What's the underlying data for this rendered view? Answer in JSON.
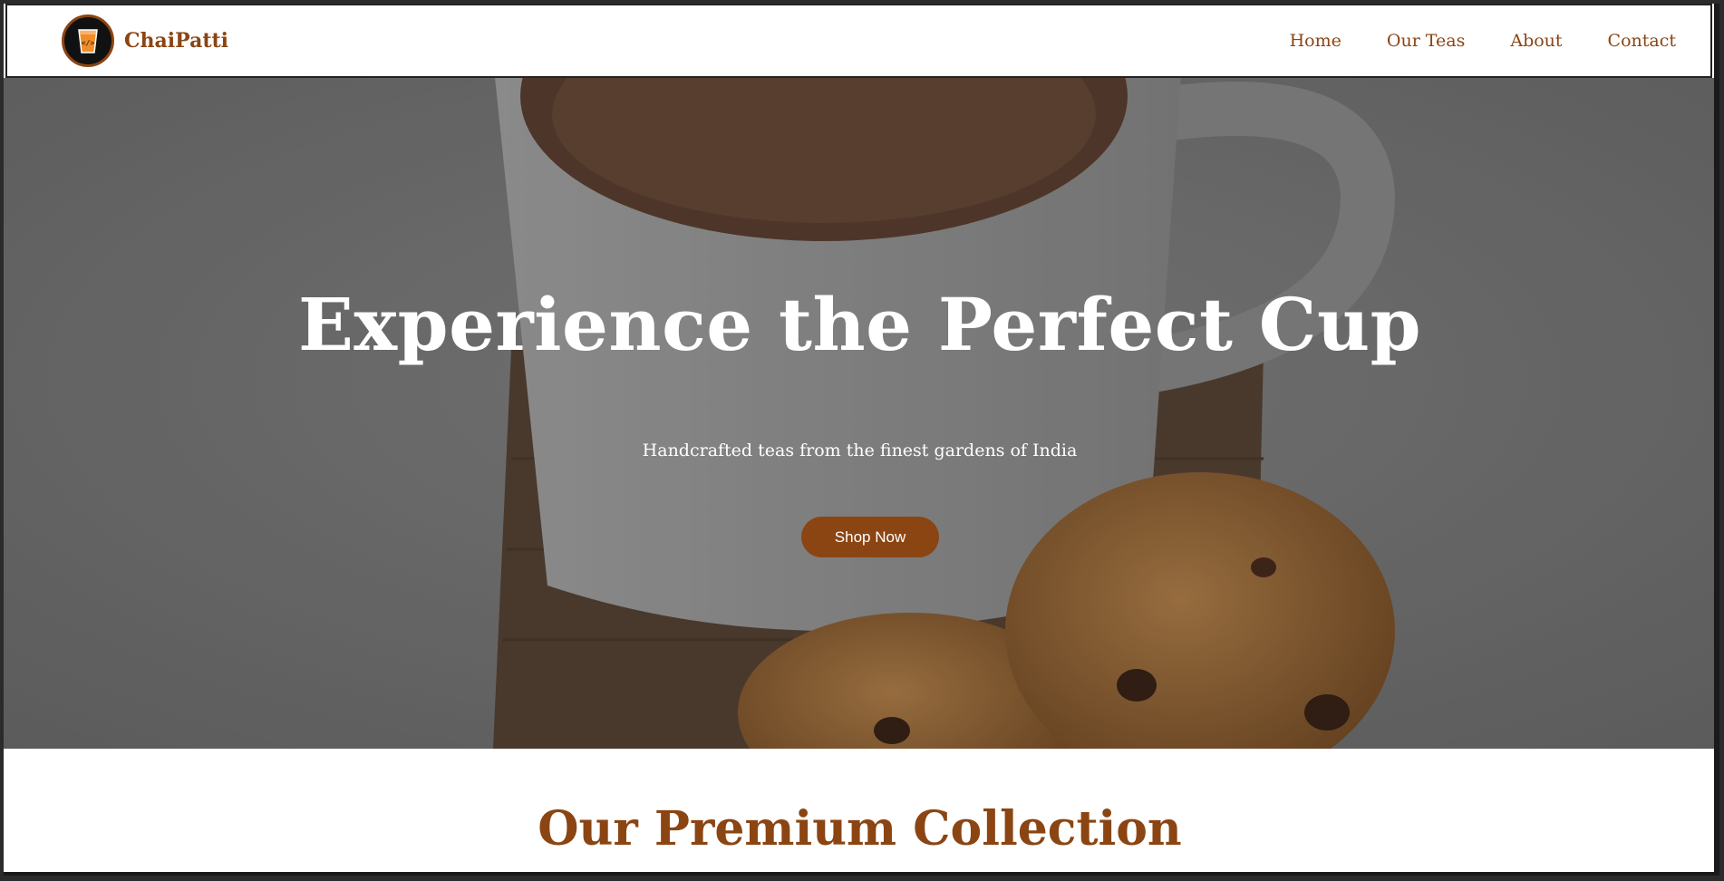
{
  "nav": {
    "brand": "ChaiPatti",
    "links": [
      "Home",
      "Our Teas",
      "About",
      "Contact"
    ]
  },
  "hero": {
    "title": "Experience the Perfect Cup",
    "subtitle": "Handcrafted teas from the finest gardens of India",
    "cta": "Shop Now"
  },
  "collection": {
    "title": "Our Premium Collection"
  },
  "colors": {
    "brand": "#8b4513",
    "overlay": "#7a7a7a",
    "text_on_hero": "#ffffff"
  },
  "icons": {
    "logo": "tea-glass-icon"
  }
}
